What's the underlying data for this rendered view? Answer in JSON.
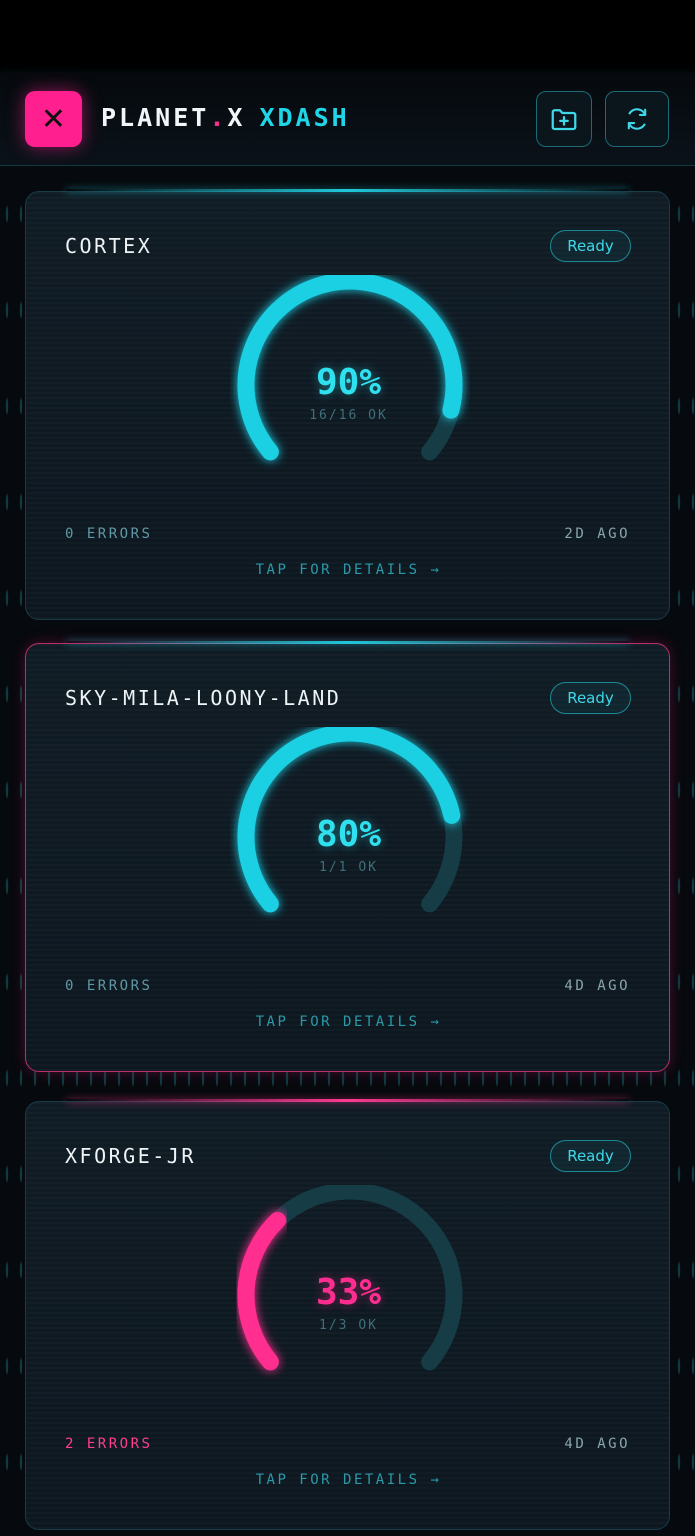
{
  "header": {
    "logo_glyph": "✕",
    "title_planet": "PLANET",
    "title_dot": ".",
    "title_x": "X",
    "title_accent": "XDASH",
    "buttons": [
      {
        "icon": "folder-plus-icon"
      },
      {
        "icon": "refresh-icon"
      }
    ]
  },
  "colors": {
    "accent": "#1fd6e8",
    "brand": "#ff1f8e",
    "gauge_track": "#163c46",
    "ok_value": "#2fe0ee",
    "warn_value": "#ff2d8f",
    "error_text": "#ff3d93"
  },
  "projects": [
    {
      "name": "CORTEX",
      "status": "Ready",
      "percent": 90,
      "percent_label": "90%",
      "ok_label": "16/16 OK",
      "errors_label": "0 ERRORS",
      "age_label": "2D AGO",
      "details_label": "TAP FOR DETAILS →",
      "gauge_color": "#1fd0e4"
    },
    {
      "name": "SKY-MILA-LOONY-LAND",
      "status": "Ready",
      "percent": 80,
      "percent_label": "80%",
      "ok_label": "1/1 OK",
      "errors_label": "0 ERRORS",
      "age_label": "4D AGO",
      "details_label": "TAP FOR DETAILS →",
      "gauge_color": "#1fd0e4"
    },
    {
      "name": "XFORGE-JR",
      "status": "Ready",
      "percent": 33,
      "percent_label": "33%",
      "ok_label": "1/3 OK",
      "errors_label": "2 ERRORS",
      "age_label": "4D AGO",
      "details_label": "TAP FOR DETAILS →",
      "gauge_color": "#ff2d8f"
    }
  ]
}
